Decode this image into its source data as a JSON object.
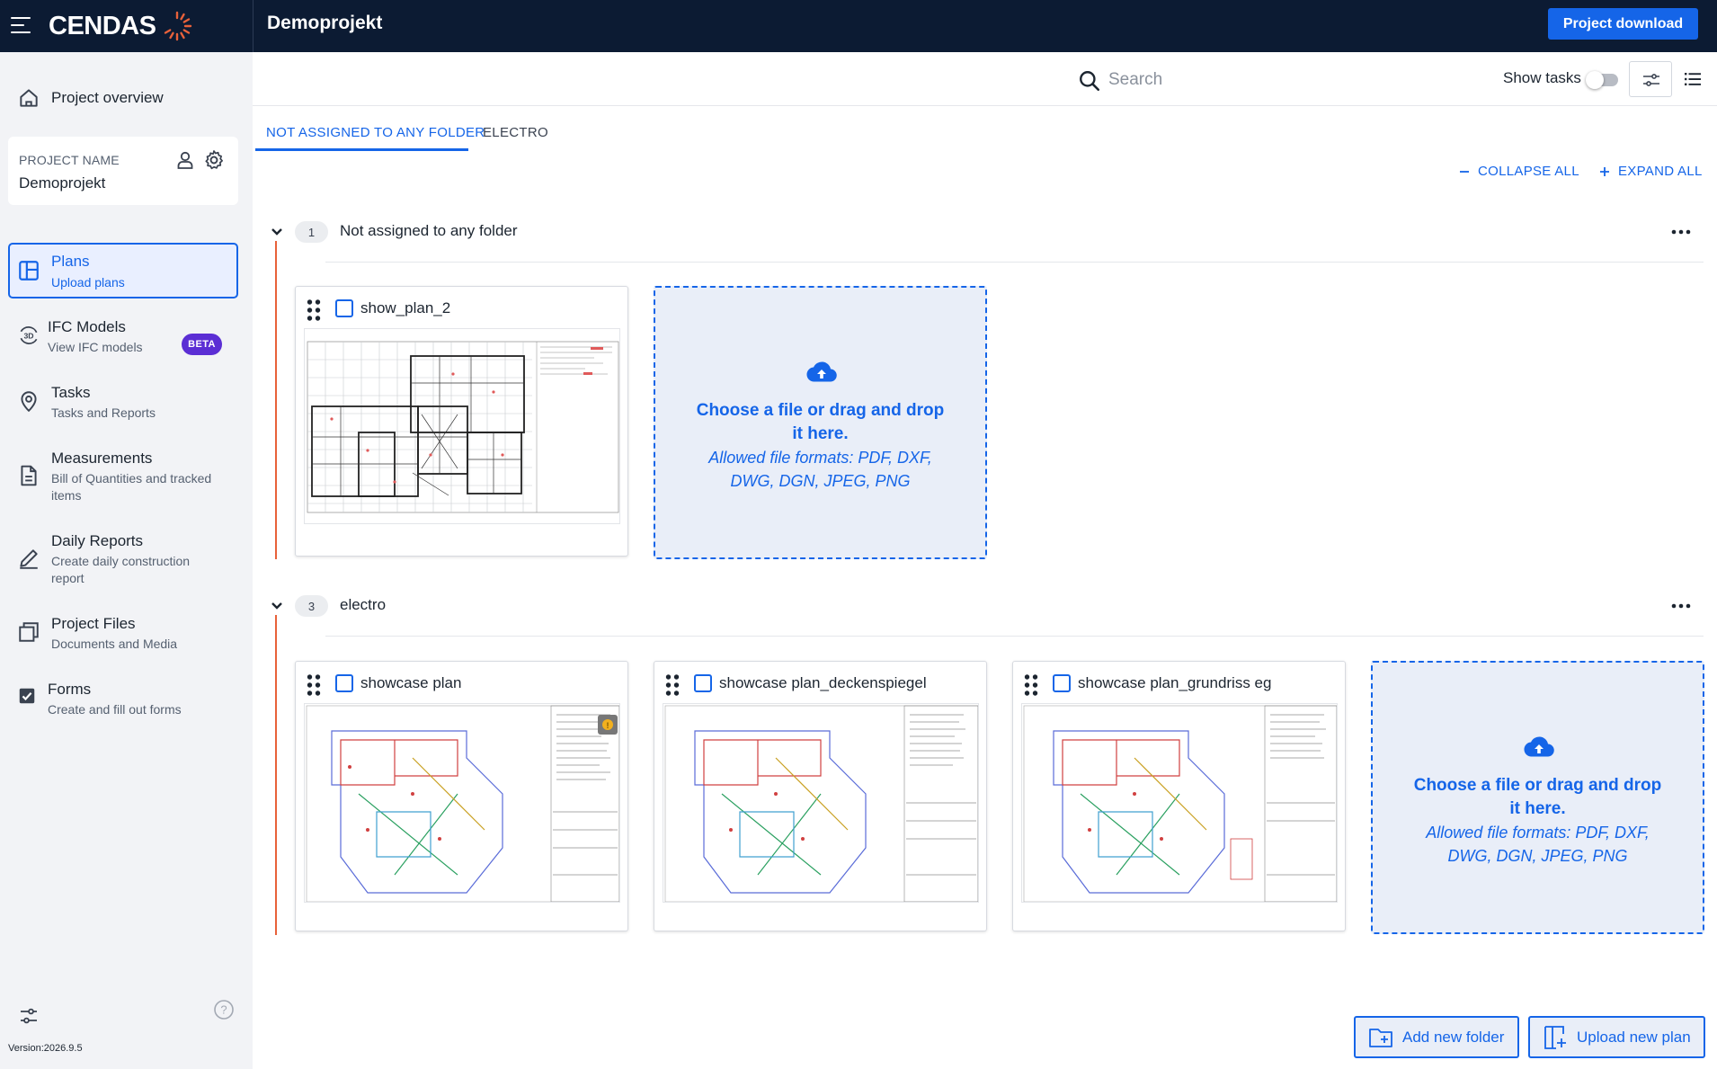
{
  "header": {
    "logo_text": "CENDAS",
    "project_title": "Demoprojekt",
    "download_label": "Project download"
  },
  "sidebar": {
    "overview_label": "Project overview",
    "project_card": {
      "label": "PROJECT NAME",
      "name": "Demoprojekt"
    },
    "items": [
      {
        "label": "Plans",
        "sub": "Upload plans",
        "icon": "plans-icon"
      },
      {
        "label": "IFC Models",
        "sub": "View IFC models",
        "icon": "3d-icon",
        "badge": "BETA"
      },
      {
        "label": "Tasks",
        "sub": "Tasks and Reports",
        "icon": "location-pin-icon"
      },
      {
        "label": "Measurements",
        "sub": "Bill of Quantities and tracked items",
        "icon": "document-icon"
      },
      {
        "label": "Daily Reports",
        "sub": "Create daily construction report",
        "icon": "pencil-icon"
      },
      {
        "label": "Project Files",
        "sub": "Documents and Media",
        "icon": "files-icon"
      },
      {
        "label": "Forms",
        "sub": "Create and fill out forms",
        "icon": "checkbox-icon"
      }
    ],
    "version": "Version:2026.9.5"
  },
  "toolbar": {
    "search_placeholder": "Search",
    "show_tasks_label": "Show tasks",
    "show_tasks_on": false
  },
  "tabs": [
    "NOT ASSIGNED TO ANY FOLDER",
    "ELECTRO"
  ],
  "controls": {
    "collapse_all": "COLLAPSE ALL",
    "expand_all": "EXPAND ALL"
  },
  "folders": [
    {
      "count": "1",
      "name": "Not assigned to any folder",
      "plans": [
        "show_plan_2"
      ]
    },
    {
      "count": "3",
      "name": "electro",
      "plans": [
        "showcase plan",
        "showcase plan_deckenspiegel",
        "showcase plan_grundriss eg"
      ]
    }
  ],
  "dropzone": {
    "title": "Choose a file or drag and drop it here.",
    "formats": "Allowed file formats: PDF, DXF, DWG, DGN, JPEG, PNG"
  },
  "footer": {
    "add_folder": "Add new folder",
    "upload_plan": "Upload new plan"
  },
  "colors": {
    "accent": "#1565e8",
    "topbar": "#0c1b33",
    "folder_line": "#e8613a",
    "beta": "#5b2ed4"
  }
}
